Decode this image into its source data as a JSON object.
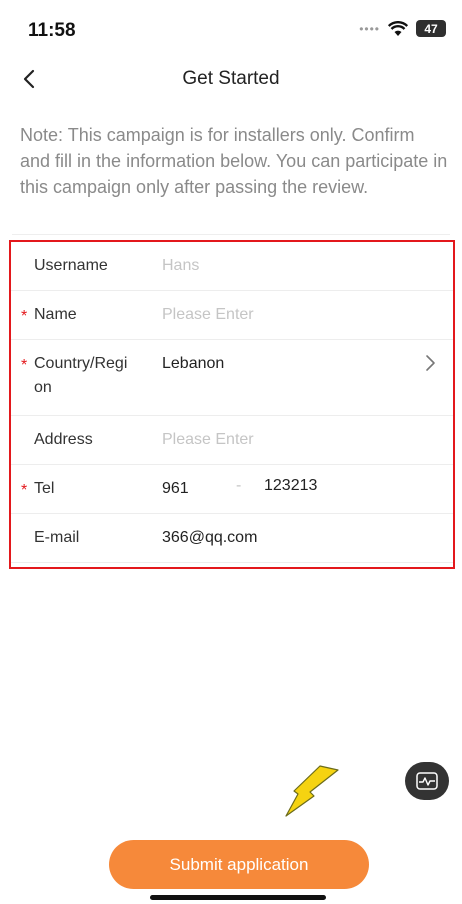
{
  "status": {
    "time": "11:58",
    "battery": "47"
  },
  "nav": {
    "title": "Get Started"
  },
  "note": "Note: This campaign is for installers only. Confirm and fill in the information below. You can participate in this campaign only after passing the review.",
  "form": {
    "username": {
      "label": "Username",
      "value": "Hans"
    },
    "name": {
      "label": "Name",
      "placeholder": "Please Enter"
    },
    "country": {
      "label_line1": "Country/Regi",
      "label_line2": "on",
      "value": "Lebanon"
    },
    "address": {
      "label": "Address",
      "placeholder": "Please Enter"
    },
    "tel": {
      "label": "Tel",
      "code": "961",
      "dash": "-",
      "number": "123213"
    },
    "email": {
      "label": "E-mail",
      "value": "366@qq.com"
    }
  },
  "submit": {
    "label": "Submit application"
  },
  "colors": {
    "accent": "#f6893a",
    "required": "#e3181c",
    "highlight_border": "#e3181c",
    "annotation_arrow": "#f5d311"
  },
  "icons": {
    "back": "chevron-left-icon",
    "row_arrow": "chevron-right-icon",
    "float": "pulse-monitor-icon",
    "wifi": "wifi-icon"
  }
}
